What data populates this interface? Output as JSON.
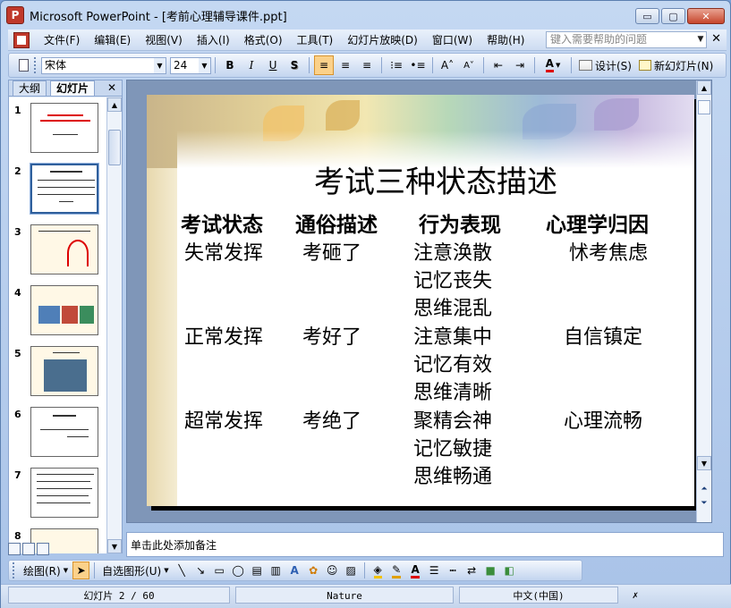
{
  "window": {
    "title": "Microsoft PowerPoint - [考前心理辅导课件.ppt]",
    "controls": [
      "▭",
      "▢",
      "✕"
    ]
  },
  "menubar": {
    "items": [
      "文件(F)",
      "编辑(E)",
      "视图(V)",
      "插入(I)",
      "格式(O)",
      "工具(T)",
      "幻灯片放映(D)",
      "窗口(W)",
      "帮助(H)"
    ],
    "help_placeholder": "键入需要帮助的问题",
    "close": "✕"
  },
  "toolbar": {
    "font_name": "宋体",
    "font_size": "24",
    "bold": "B",
    "italic": "I",
    "underline": "U",
    "shadow": "S",
    "design_label": "设计(S)",
    "new_slide_label": "新幻灯片(N)",
    "font_color_label": "A"
  },
  "left_panel": {
    "tabs": [
      "大纲",
      "幻灯片"
    ],
    "close": "✕",
    "thumbnails": [
      {
        "number": "1"
      },
      {
        "number": "2"
      },
      {
        "number": "3"
      },
      {
        "number": "4"
      },
      {
        "number": "5"
      },
      {
        "number": "6"
      },
      {
        "number": "7"
      },
      {
        "number": "8"
      }
    ]
  },
  "slide": {
    "title": "考试三种状态描述",
    "headers": [
      "考试状态",
      "通俗描述",
      "行为表现",
      "心理学归因"
    ],
    "rows": [
      {
        "state": "失常发挥",
        "plain": "考砸了",
        "behaviors": [
          "注意涣散",
          "记忆丧失",
          "思维混乱"
        ],
        "cause": "怵考焦虑"
      },
      {
        "state": "正常发挥",
        "plain": "考好了",
        "behaviors": [
          "注意集中",
          "记忆有效",
          "思维清晰"
        ],
        "cause": "自信镇定"
      },
      {
        "state": "超常发挥",
        "plain": "考绝了",
        "behaviors": [
          "聚精会神",
          "记忆敏捷",
          "思维畅通"
        ],
        "cause": "心理流畅"
      }
    ]
  },
  "notes": {
    "placeholder": "单击此处添加备注"
  },
  "draw_toolbar": {
    "draw_label": "绘图(R)",
    "autoshapes_label": "自选图形(U)"
  },
  "statusbar": {
    "slide_info": "幻灯片 2 / 60",
    "design": "Nature",
    "language": "中文(中国)"
  },
  "colors": {
    "title_red": "#d00000",
    "selection_blue": "#2f5f9c"
  }
}
